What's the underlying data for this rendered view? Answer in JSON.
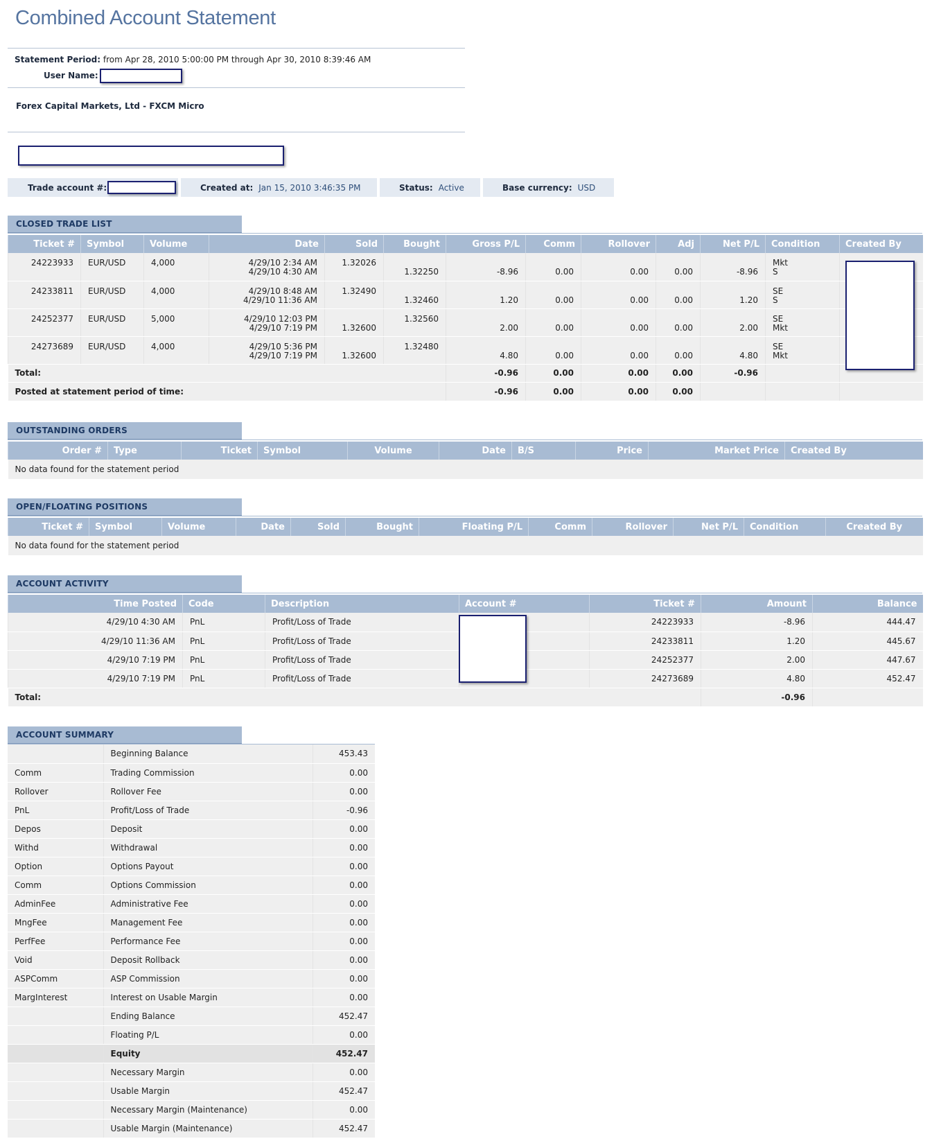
{
  "page_title": "Combined Account Statement",
  "statement": {
    "period_label": "Statement Period:",
    "period_value": "from Apr 28, 2010 5:00:00 PM through Apr 30, 2010 8:39:46 AM",
    "user_label": "User Name:",
    "company": "Forex Capital Markets, Ltd - FXCM Micro"
  },
  "account_info": {
    "trade_account_label": "Trade account #:",
    "created_label": "Created at:",
    "created_value": "Jan 15, 2010 3:46:35 PM",
    "status_label": "Status:",
    "status_value": "Active",
    "currency_label": "Base currency:",
    "currency_value": "USD"
  },
  "closed_trades": {
    "section_title": "CLOSED TRADE LIST",
    "headers": [
      "Ticket #",
      "Symbol",
      "Volume",
      "Date",
      "Sold",
      "Bought",
      "Gross P/L",
      "Comm",
      "Rollover",
      "Adj",
      "Net P/L",
      "Condition",
      "Created By"
    ],
    "rows": [
      {
        "ticket": "24223933",
        "symbol": "EUR/USD",
        "volume": "4,000",
        "date1": "4/29/10 2:34 AM",
        "date2": "4/29/10 4:30 AM",
        "sold1": "1.32026",
        "sold2": "",
        "bought1": "",
        "bought2": "1.32250",
        "gross": "-8.96",
        "comm": "0.00",
        "rollover": "0.00",
        "adj": "0.00",
        "net": "-8.96",
        "cond1": "Mkt",
        "cond2": "S"
      },
      {
        "ticket": "24233811",
        "symbol": "EUR/USD",
        "volume": "4,000",
        "date1": "4/29/10 8:48 AM",
        "date2": "4/29/10 11:36 AM",
        "sold1": "1.32490",
        "sold2": "",
        "bought1": "",
        "bought2": "1.32460",
        "gross": "1.20",
        "comm": "0.00",
        "rollover": "0.00",
        "adj": "0.00",
        "net": "1.20",
        "cond1": "SE",
        "cond2": "S"
      },
      {
        "ticket": "24252377",
        "symbol": "EUR/USD",
        "volume": "5,000",
        "date1": "4/29/10 12:03 PM",
        "date2": "4/29/10 7:19 PM",
        "sold1": "",
        "sold2": "1.32600",
        "bought1": "1.32560",
        "bought2": "",
        "gross": "2.00",
        "comm": "0.00",
        "rollover": "0.00",
        "adj": "0.00",
        "net": "2.00",
        "cond1": "SE",
        "cond2": "Mkt"
      },
      {
        "ticket": "24273689",
        "symbol": "EUR/USD",
        "volume": "4,000",
        "date1": "4/29/10 5:36 PM",
        "date2": "4/29/10 7:19 PM",
        "sold1": "",
        "sold2": "1.32600",
        "bought1": "1.32480",
        "bought2": "",
        "gross": "4.80",
        "comm": "0.00",
        "rollover": "0.00",
        "adj": "0.00",
        "net": "4.80",
        "cond1": "SE",
        "cond2": "Mkt"
      }
    ],
    "total_label": "Total:",
    "total": {
      "gross": "-0.96",
      "comm": "0.00",
      "rollover": "0.00",
      "adj": "0.00",
      "net": "-0.96"
    },
    "posted_label": "Posted at statement period of time:",
    "posted": {
      "gross": "-0.96",
      "comm": "0.00",
      "rollover": "0.00",
      "adj": "0.00"
    }
  },
  "outstanding_orders": {
    "section_title": "OUTSTANDING ORDERS",
    "headers": [
      "Order #",
      "Type",
      "Ticket",
      "Symbol",
      "Volume",
      "Date",
      "B/S",
      "Price",
      "Market Price",
      "Created By"
    ],
    "no_data": "No data found for the statement period"
  },
  "open_positions": {
    "section_title": "OPEN/FLOATING POSITIONS",
    "headers": [
      "Ticket #",
      "Symbol",
      "Volume",
      "Date",
      "Sold",
      "Bought",
      "Floating P/L",
      "Comm",
      "Rollover",
      "Net P/L",
      "Condition",
      "Created By"
    ],
    "no_data": "No data found for the statement period"
  },
  "account_activity": {
    "section_title": "ACCOUNT ACTIVITY",
    "headers": [
      "Time Posted",
      "Code",
      "Description",
      "Account #",
      "Ticket #",
      "Amount",
      "Balance"
    ],
    "rows": [
      {
        "time": "4/29/10 4:30 AM",
        "code": "PnL",
        "desc": "Profit/Loss of Trade",
        "ticket": "24223933",
        "amount": "-8.96",
        "balance": "444.47"
      },
      {
        "time": "4/29/10 11:36 AM",
        "code": "PnL",
        "desc": "Profit/Loss of Trade",
        "ticket": "24233811",
        "amount": "1.20",
        "balance": "445.67"
      },
      {
        "time": "4/29/10 7:19 PM",
        "code": "PnL",
        "desc": "Profit/Loss of Trade",
        "ticket": "24252377",
        "amount": "2.00",
        "balance": "447.67"
      },
      {
        "time": "4/29/10 7:19 PM",
        "code": "PnL",
        "desc": "Profit/Loss of Trade",
        "ticket": "24273689",
        "amount": "4.80",
        "balance": "452.47"
      }
    ],
    "total_label": "Total:",
    "total_amount": "-0.96"
  },
  "account_summary": {
    "section_title": "ACCOUNT SUMMARY",
    "rows": [
      {
        "code": "",
        "desc": "Beginning Balance",
        "value": "453.43"
      },
      {
        "code": "Comm",
        "desc": "Trading Commission",
        "value": "0.00"
      },
      {
        "code": "Rollover",
        "desc": "Rollover Fee",
        "value": "0.00"
      },
      {
        "code": "PnL",
        "desc": "Profit/Loss of Trade",
        "value": "-0.96"
      },
      {
        "code": "Depos",
        "desc": "Deposit",
        "value": "0.00"
      },
      {
        "code": "Withd",
        "desc": "Withdrawal",
        "value": "0.00"
      },
      {
        "code": "Option",
        "desc": "Options Payout",
        "value": "0.00"
      },
      {
        "code": "Comm",
        "desc": "Options Commission",
        "value": "0.00"
      },
      {
        "code": "AdminFee",
        "desc": "Administrative Fee",
        "value": "0.00"
      },
      {
        "code": "MngFee",
        "desc": "Management Fee",
        "value": "0.00"
      },
      {
        "code": "PerfFee",
        "desc": "Performance Fee",
        "value": "0.00"
      },
      {
        "code": "Void",
        "desc": "Deposit Rollback",
        "value": "0.00"
      },
      {
        "code": "ASPComm",
        "desc": "ASP Commission",
        "value": "0.00"
      },
      {
        "code": "MargInterest",
        "desc": "Interest on Usable Margin",
        "value": "0.00"
      },
      {
        "code": "",
        "desc": "Ending Balance",
        "value": "452.47"
      },
      {
        "code": "",
        "desc": "Floating P/L",
        "value": "0.00"
      },
      {
        "code": "",
        "desc": "Equity",
        "value": "452.47"
      },
      {
        "code": "",
        "desc": "Necessary Margin",
        "value": "0.00"
      },
      {
        "code": "",
        "desc": "Usable Margin",
        "value": "452.47"
      },
      {
        "code": "",
        "desc": "Necessary Margin (Maintenance)",
        "value": "0.00"
      },
      {
        "code": "",
        "desc": "Usable Margin (Maintenance)",
        "value": "452.47"
      }
    ]
  }
}
